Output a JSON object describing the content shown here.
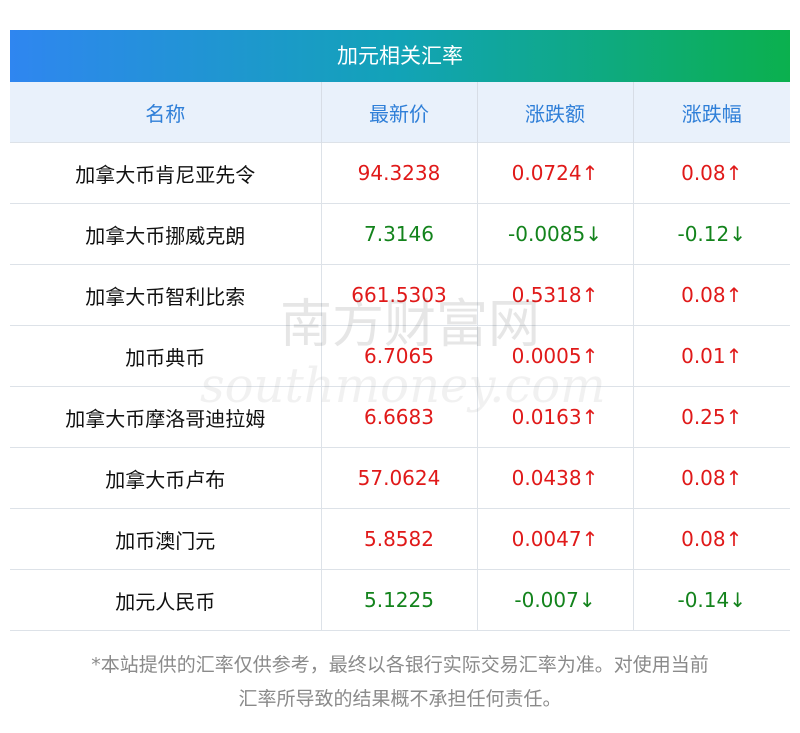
{
  "header": {
    "title": "加元相关汇率"
  },
  "columns": [
    "名称",
    "最新价",
    "涨跌额",
    "涨跌幅"
  ],
  "rows": [
    {
      "name": "加拿大币肯尼亚先令",
      "price": "94.3238",
      "change": "0.0724↑",
      "pct": "0.08↑",
      "dir": "up"
    },
    {
      "name": "加拿大币挪威克朗",
      "price": "7.3146",
      "change": "-0.0085↓",
      "pct": "-0.12↓",
      "dir": "down"
    },
    {
      "name": "加拿大币智利比索",
      "price": "661.5303",
      "change": "0.5318↑",
      "pct": "0.08↑",
      "dir": "up"
    },
    {
      "name": "加币典币",
      "price": "6.7065",
      "change": "0.0005↑",
      "pct": "0.01↑",
      "dir": "up"
    },
    {
      "name": "加拿大币摩洛哥迪拉姆",
      "price": "6.6683",
      "change": "0.0163↑",
      "pct": "0.25↑",
      "dir": "up"
    },
    {
      "name": "加拿大币卢布",
      "price": "57.0624",
      "change": "0.0438↑",
      "pct": "0.08↑",
      "dir": "up"
    },
    {
      "name": "加币澳门元",
      "price": "5.8582",
      "change": "0.0047↑",
      "pct": "0.08↑",
      "dir": "up"
    },
    {
      "name": "加元人民币",
      "price": "5.1225",
      "change": "-0.007↓",
      "pct": "-0.14↓",
      "dir": "down"
    }
  ],
  "watermark": {
    "cn": "南方财富网",
    "en": "southmoney.com"
  },
  "disclaimer": {
    "line1": "*本站提供的汇率仅供参考，最终以各银行实际交易汇率为准。对使用当前",
    "line2": "汇率所导致的结果概不承担任何责任。"
  },
  "colors": {
    "up": "#e01919",
    "down": "#13831c",
    "header_text": "#2f7fd8"
  }
}
